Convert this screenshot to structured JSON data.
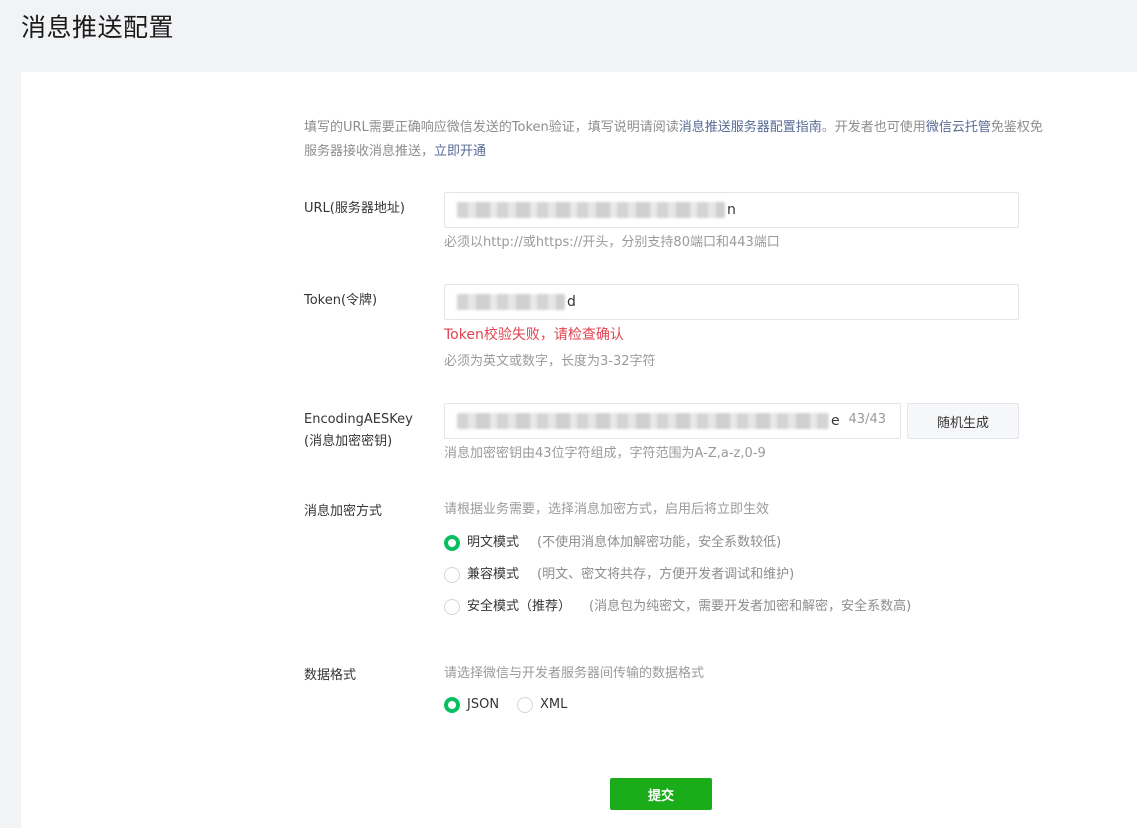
{
  "page": {
    "title": "消息推送配置"
  },
  "intro": {
    "part1": "填写的URL需要正确响应微信发送的Token验证，填写说明请阅读",
    "link_guide": "消息推送服务器配置指南",
    "part2": "。开发者也可使用",
    "link_cloud": "微信云托管",
    "part3": "免鉴权免服务器接收消息推送，",
    "link_open": "立即开通"
  },
  "url_field": {
    "label": "URL(服务器地址)",
    "value_tail": "n",
    "hint": "必须以http://或https://开头，分别支持80端口和443端口"
  },
  "token_field": {
    "label": "Token(令牌)",
    "value_tail": "d",
    "error": "Token校验失败，请检查确认",
    "hint": "必须为英文或数字，长度为3-32字符"
  },
  "aes_field": {
    "label_line1": "EncodingAESKey",
    "label_line2": "(消息加密密钥)",
    "value_tail": "e",
    "counter": "43/43",
    "generate_button": "随机生成",
    "hint": "消息加密密钥由43位字符组成，字符范围为A-Z,a-z,0-9"
  },
  "encryption": {
    "label": "消息加密方式",
    "hint": "请根据业务需要，选择消息加密方式，启用后将立即生效",
    "options": [
      {
        "label": "明文模式",
        "note": "(不使用消息体加解密功能，安全系数较低)",
        "checked": true
      },
      {
        "label": "兼容模式",
        "note": "(明文、密文将共存，方便开发者调试和维护)",
        "checked": false
      },
      {
        "label": "安全模式（推荐）",
        "note": "(消息包为纯密文，需要开发者加密和解密，安全系数高)",
        "checked": false
      }
    ]
  },
  "format": {
    "label": "数据格式",
    "hint": "请选择微信与开发者服务器间传输的数据格式",
    "options": [
      {
        "label": "JSON",
        "checked": true
      },
      {
        "label": "XML",
        "checked": false
      }
    ]
  },
  "submit_label": "提交",
  "colors": {
    "accent": "#07c160",
    "button_green": "#1aad19",
    "error": "#e2424f",
    "link": "#576b95"
  }
}
